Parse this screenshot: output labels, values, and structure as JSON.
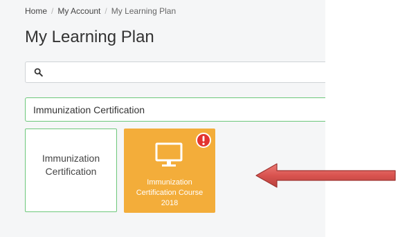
{
  "breadcrumb": {
    "items": [
      "Home",
      "My Account",
      "My Learning Plan"
    ],
    "separator": "/"
  },
  "page": {
    "title": "My Learning Plan"
  },
  "search": {
    "value": "",
    "placeholder": "",
    "icon": "search-icon"
  },
  "plan_select": {
    "selected": "Immunization Certification"
  },
  "plan_card": {
    "line1": "Immunization",
    "line2": "Certification"
  },
  "course_card": {
    "line1": "Immunization",
    "line2": "Certification Course",
    "line3": "2018",
    "icon": "monitor-icon",
    "alert_icon": "exclamation-alert-icon"
  },
  "colors": {
    "accent_green": "#6cc77a",
    "course_orange": "#f3ad3a",
    "alert_red": "#e3342f",
    "arrow_red": "#d9534f"
  }
}
